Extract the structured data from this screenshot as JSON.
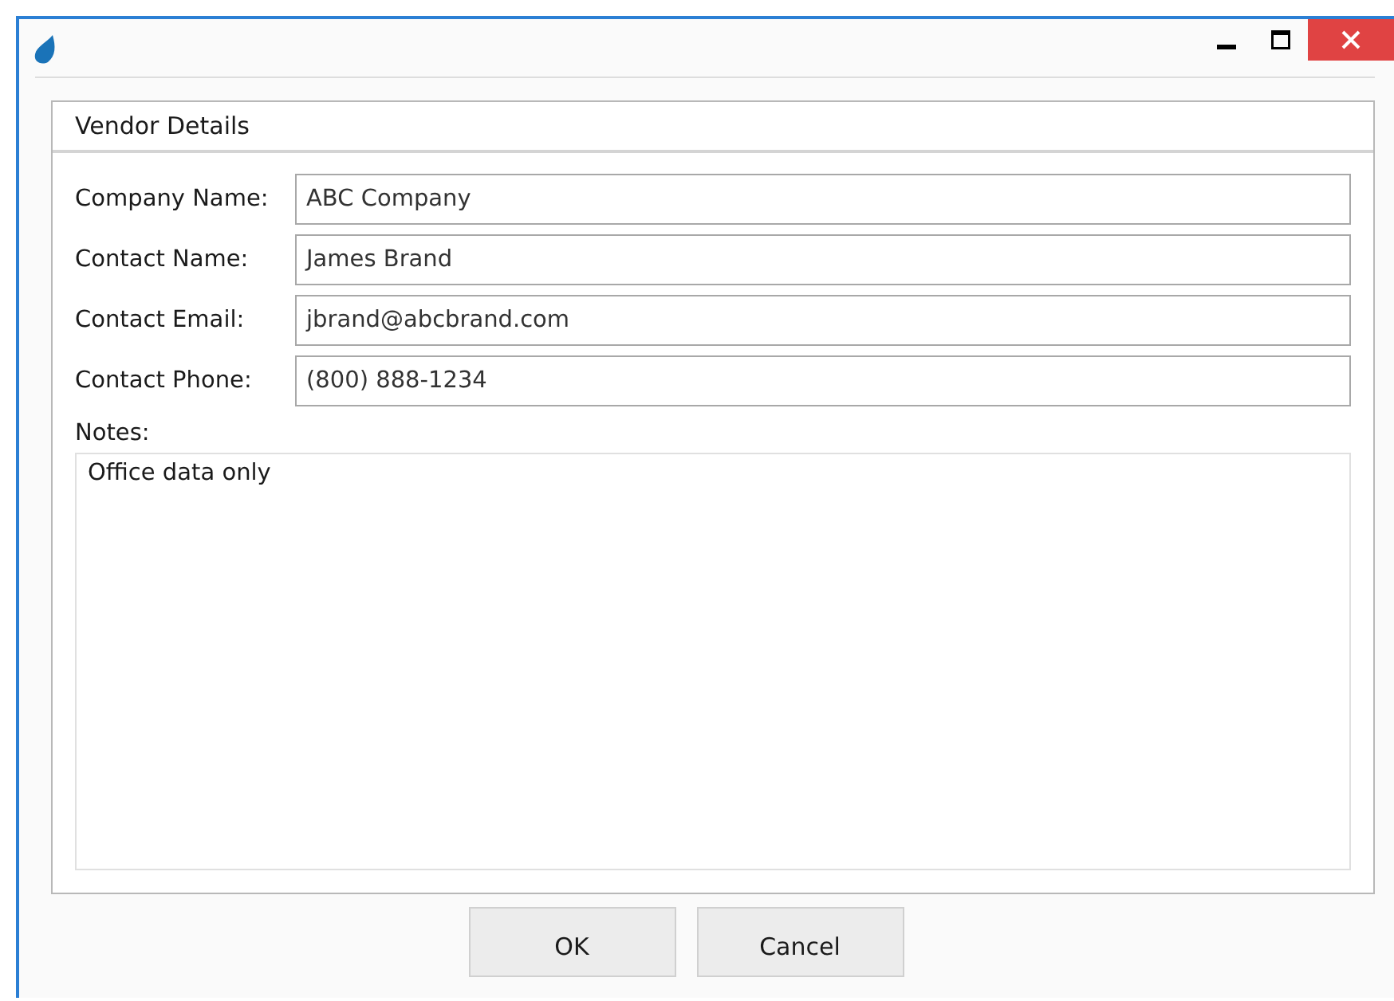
{
  "window": {
    "buttons": [
      {
        "kind": "minimize"
      },
      {
        "kind": "maximize"
      },
      {
        "kind": "close"
      }
    ]
  },
  "panel": {
    "title": "Vendor Details",
    "fields": [
      {
        "label": "Company Name:",
        "value": "ABC Company"
      },
      {
        "label": "Contact Name:",
        "value": "James Brand"
      },
      {
        "label": "Contact Email:",
        "value": "jbrand@abcbrand.com"
      },
      {
        "label": "Contact Phone:",
        "value": "(800) 888-1234"
      }
    ],
    "notes": {
      "label": "Notes:",
      "value": "Office data only"
    }
  },
  "buttons": [
    "OK",
    "Cancel"
  ]
}
